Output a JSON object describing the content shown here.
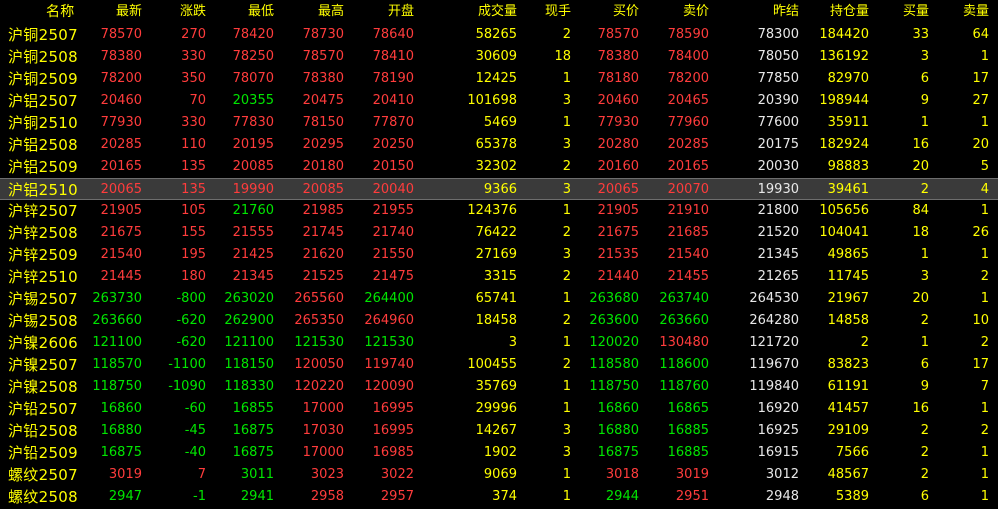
{
  "columns": {
    "name": "名称",
    "last": "最新",
    "change": "涨跌",
    "low": "最低",
    "high": "最高",
    "open": "开盘",
    "volume": "成交量",
    "current": "现手",
    "bid": "买价",
    "ask": "卖价",
    "prev_settle": "昨结",
    "open_interest": "持仓量",
    "bid_vol": "买量",
    "ask_vol": "卖量"
  },
  "colors": {
    "up": "#ff3c3c",
    "down": "#00e600",
    "flat": "#e8e8e8",
    "header": "#ffff00",
    "highlight": "#3a3a3a"
  },
  "selected_row": 7,
  "rows": [
    {
      "name": "沪铜2507",
      "last": "78570",
      "change": "270",
      "low": "78420",
      "high": "78730",
      "open": "78640",
      "volume": "58265",
      "current": "2",
      "bid": "78570",
      "ask": "78590",
      "prev_settle": "78300",
      "open_interest": "184420",
      "bid_vol": "33",
      "ask_vol": "64"
    },
    {
      "name": "沪铜2508",
      "last": "78380",
      "change": "330",
      "low": "78250",
      "high": "78570",
      "open": "78410",
      "volume": "30609",
      "current": "18",
      "bid": "78380",
      "ask": "78400",
      "prev_settle": "78050",
      "open_interest": "136192",
      "bid_vol": "3",
      "ask_vol": "1"
    },
    {
      "name": "沪铜2509",
      "last": "78200",
      "change": "350",
      "low": "78070",
      "high": "78380",
      "open": "78190",
      "volume": "12425",
      "current": "1",
      "bid": "78180",
      "ask": "78200",
      "prev_settle": "77850",
      "open_interest": "82970",
      "bid_vol": "6",
      "ask_vol": "17"
    },
    {
      "name": "沪铝2507",
      "last": "20460",
      "change": "70",
      "low": "20355",
      "high": "20475",
      "open": "20410",
      "volume": "101698",
      "current": "3",
      "bid": "20460",
      "ask": "20465",
      "prev_settle": "20390",
      "open_interest": "198944",
      "bid_vol": "9",
      "ask_vol": "27"
    },
    {
      "name": "沪铜2510",
      "last": "77930",
      "change": "330",
      "low": "77830",
      "high": "78150",
      "open": "77870",
      "volume": "5469",
      "current": "1",
      "bid": "77930",
      "ask": "77960",
      "prev_settle": "77600",
      "open_interest": "35911",
      "bid_vol": "1",
      "ask_vol": "1"
    },
    {
      "name": "沪铝2508",
      "last": "20285",
      "change": "110",
      "low": "20195",
      "high": "20295",
      "open": "20250",
      "volume": "65378",
      "current": "3",
      "bid": "20280",
      "ask": "20285",
      "prev_settle": "20175",
      "open_interest": "182924",
      "bid_vol": "16",
      "ask_vol": "20"
    },
    {
      "name": "沪铝2509",
      "last": "20165",
      "change": "135",
      "low": "20085",
      "high": "20180",
      "open": "20150",
      "volume": "32302",
      "current": "2",
      "bid": "20160",
      "ask": "20165",
      "prev_settle": "20030",
      "open_interest": "98883",
      "bid_vol": "20",
      "ask_vol": "5"
    },
    {
      "name": "沪铝2510",
      "last": "20065",
      "change": "135",
      "low": "19990",
      "high": "20085",
      "open": "20040",
      "volume": "9366",
      "current": "3",
      "bid": "20065",
      "ask": "20070",
      "prev_settle": "19930",
      "open_interest": "39461",
      "bid_vol": "2",
      "ask_vol": "4"
    },
    {
      "name": "沪锌2507",
      "last": "21905",
      "change": "105",
      "low": "21760",
      "high": "21985",
      "open": "21955",
      "volume": "124376",
      "current": "1",
      "bid": "21905",
      "ask": "21910",
      "prev_settle": "21800",
      "open_interest": "105656",
      "bid_vol": "84",
      "ask_vol": "1"
    },
    {
      "name": "沪锌2508",
      "last": "21675",
      "change": "155",
      "low": "21555",
      "high": "21745",
      "open": "21740",
      "volume": "76422",
      "current": "2",
      "bid": "21675",
      "ask": "21685",
      "prev_settle": "21520",
      "open_interest": "104041",
      "bid_vol": "18",
      "ask_vol": "26"
    },
    {
      "name": "沪锌2509",
      "last": "21540",
      "change": "195",
      "low": "21425",
      "high": "21620",
      "open": "21550",
      "volume": "27169",
      "current": "3",
      "bid": "21535",
      "ask": "21540",
      "prev_settle": "21345",
      "open_interest": "49865",
      "bid_vol": "1",
      "ask_vol": "1"
    },
    {
      "name": "沪锌2510",
      "last": "21445",
      "change": "180",
      "low": "21345",
      "high": "21525",
      "open": "21475",
      "volume": "3315",
      "current": "2",
      "bid": "21440",
      "ask": "21455",
      "prev_settle": "21265",
      "open_interest": "11745",
      "bid_vol": "3",
      "ask_vol": "2"
    },
    {
      "name": "沪锡2507",
      "last": "263730",
      "change": "-800",
      "low": "263020",
      "high": "265560",
      "open": "264400",
      "volume": "65741",
      "current": "1",
      "bid": "263680",
      "ask": "263740",
      "prev_settle": "264530",
      "open_interest": "21967",
      "bid_vol": "20",
      "ask_vol": "1"
    },
    {
      "name": "沪锡2508",
      "last": "263660",
      "change": "-620",
      "low": "262900",
      "high": "265350",
      "open": "264960",
      "volume": "18458",
      "current": "2",
      "bid": "263600",
      "ask": "263660",
      "prev_settle": "264280",
      "open_interest": "14858",
      "bid_vol": "2",
      "ask_vol": "10"
    },
    {
      "name": "沪镍2606",
      "last": "121100",
      "change": "-620",
      "low": "121100",
      "high": "121530",
      "open": "121530",
      "volume": "3",
      "current": "1",
      "bid": "120020",
      "ask": "130480",
      "prev_settle": "121720",
      "open_interest": "2",
      "bid_vol": "1",
      "ask_vol": "2"
    },
    {
      "name": "沪镍2507",
      "last": "118570",
      "change": "-1100",
      "low": "118150",
      "high": "120050",
      "open": "119740",
      "volume": "100455",
      "current": "2",
      "bid": "118580",
      "ask": "118600",
      "prev_settle": "119670",
      "open_interest": "83823",
      "bid_vol": "6",
      "ask_vol": "17"
    },
    {
      "name": "沪镍2508",
      "last": "118750",
      "change": "-1090",
      "low": "118330",
      "high": "120220",
      "open": "120090",
      "volume": "35769",
      "current": "1",
      "bid": "118750",
      "ask": "118760",
      "prev_settle": "119840",
      "open_interest": "61191",
      "bid_vol": "9",
      "ask_vol": "7"
    },
    {
      "name": "沪铅2507",
      "last": "16860",
      "change": "-60",
      "low": "16855",
      "high": "17000",
      "open": "16995",
      "volume": "29996",
      "current": "1",
      "bid": "16860",
      "ask": "16865",
      "prev_settle": "16920",
      "open_interest": "41457",
      "bid_vol": "16",
      "ask_vol": "1"
    },
    {
      "name": "沪铅2508",
      "last": "16880",
      "change": "-45",
      "low": "16875",
      "high": "17030",
      "open": "16995",
      "volume": "14267",
      "current": "3",
      "bid": "16880",
      "ask": "16885",
      "prev_settle": "16925",
      "open_interest": "29109",
      "bid_vol": "2",
      "ask_vol": "2"
    },
    {
      "name": "沪铅2509",
      "last": "16875",
      "change": "-40",
      "low": "16875",
      "high": "17000",
      "open": "16985",
      "volume": "1902",
      "current": "3",
      "bid": "16875",
      "ask": "16885",
      "prev_settle": "16915",
      "open_interest": "7566",
      "bid_vol": "2",
      "ask_vol": "1"
    },
    {
      "name": "螺纹2507",
      "last": "3019",
      "change": "7",
      "low": "3011",
      "high": "3023",
      "open": "3022",
      "volume": "9069",
      "current": "1",
      "bid": "3018",
      "ask": "3019",
      "prev_settle": "3012",
      "open_interest": "48567",
      "bid_vol": "2",
      "ask_vol": "1"
    },
    {
      "name": "螺纹2508",
      "last": "2947",
      "change": "-1",
      "low": "2941",
      "high": "2958",
      "open": "2957",
      "volume": "374",
      "current": "1",
      "bid": "2944",
      "ask": "2951",
      "prev_settle": "2948",
      "open_interest": "5389",
      "bid_vol": "6",
      "ask_vol": "1"
    }
  ]
}
